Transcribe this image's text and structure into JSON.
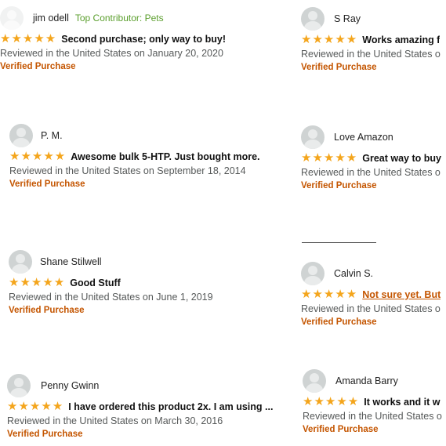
{
  "reviews": [
    {
      "name": "jim odell",
      "contributor": "Top Contributor: Pets",
      "stars": "★★★★★",
      "title": "Second purchase; only way to buy!",
      "date": "Reviewed in the United States on January 20, 2020",
      "verified": "Verified Purchase"
    },
    {
      "name": "P. M.",
      "stars": "★★★★★",
      "title": "Awesome bulk 5-HTP. Just bought more.",
      "date": "Reviewed in the United States on September 18, 2014",
      "verified": "Verified Purchase"
    },
    {
      "name": "Shane Stilwell",
      "stars": "★★★★★",
      "title": "Good Stuff",
      "date": "Reviewed in the United States on June 1, 2019",
      "verified": "Verified Purchase"
    },
    {
      "name": "Penny Gwinn",
      "stars": "★★★★★",
      "title": "I have ordered this product 2x. I am using ...",
      "date": "Reviewed in the United States on March 30, 2016",
      "verified": "Verified Purchase"
    },
    {
      "name": "S Ray",
      "stars": "★★★★★",
      "title": "Works amazing f",
      "date": "Reviewed in the United States o",
      "verified": "Verified Purchase"
    },
    {
      "name": "Love Amazon",
      "stars": "★★★★★",
      "title": "Great way to buy",
      "date": "Reviewed in the United States o",
      "verified": "Verified Purchase"
    },
    {
      "name": "Calvin S.",
      "stars": "★★★★★",
      "title": "Not sure yet. But",
      "date": "Reviewed in the United States o",
      "verified": "Verified Purchase"
    },
    {
      "name": "Amanda Barry",
      "stars": "★★★★★",
      "title": "It works and it w",
      "date": "Reviewed in the United States o",
      "verified": "Verified Purchase"
    }
  ],
  "colors": {
    "star": "#f4a51c",
    "verified": "#c45500",
    "contributor": "#5a9e2c",
    "meta": "#565959"
  },
  "icons": {
    "avatar": "avatar-icon",
    "badge": "top-contributor-badge-icon",
    "star": "star-icon"
  }
}
